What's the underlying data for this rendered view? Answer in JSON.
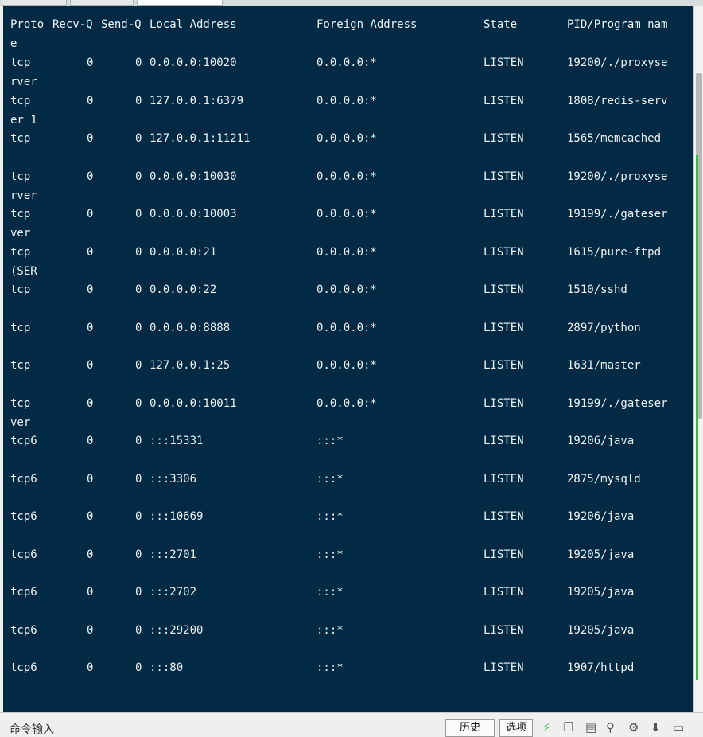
{
  "header": {
    "proto": "Proto",
    "recvq": "Recv-Q",
    "sendq": "Send-Q",
    "local": "Local Address",
    "foreign": "Foreign Address",
    "state": "State",
    "pid": "PID/Program nam",
    "wrap": "e"
  },
  "rows": [
    {
      "proto": "tcp",
      "recvq": "0",
      "sendq": "0",
      "local": "0.0.0.0:10020",
      "foreign": "0.0.0.0:*",
      "state": "LISTEN",
      "pid": "19200/./proxyse",
      "wrap": "rver"
    },
    {
      "proto": "tcp",
      "recvq": "0",
      "sendq": "0",
      "local": "127.0.0.1:6379",
      "foreign": "0.0.0.0:*",
      "state": "LISTEN",
      "pid": "1808/redis-serv",
      "wrap": "er 1"
    },
    {
      "proto": "tcp",
      "recvq": "0",
      "sendq": "0",
      "local": "127.0.0.1:11211",
      "foreign": "0.0.0.0:*",
      "state": "LISTEN",
      "pid": "1565/memcached",
      "wrap": ""
    },
    {
      "proto": "tcp",
      "recvq": "0",
      "sendq": "0",
      "local": "0.0.0.0:10030",
      "foreign": "0.0.0.0:*",
      "state": "LISTEN",
      "pid": "19200/./proxyse",
      "wrap": "rver"
    },
    {
      "proto": "tcp",
      "recvq": "0",
      "sendq": "0",
      "local": "0.0.0.0:10003",
      "foreign": "0.0.0.0:*",
      "state": "LISTEN",
      "pid": "19199/./gateser",
      "wrap": "ver"
    },
    {
      "proto": "tcp",
      "recvq": "0",
      "sendq": "0",
      "local": "0.0.0.0:21",
      "foreign": "0.0.0.0:*",
      "state": "LISTEN",
      "pid": "1615/pure-ftpd",
      "wrap": "(SER"
    },
    {
      "proto": "tcp",
      "recvq": "0",
      "sendq": "0",
      "local": "0.0.0.0:22",
      "foreign": "0.0.0.0:*",
      "state": "LISTEN",
      "pid": "1510/sshd",
      "wrap": ""
    },
    {
      "proto": "tcp",
      "recvq": "0",
      "sendq": "0",
      "local": "0.0.0.0:8888",
      "foreign": "0.0.0.0:*",
      "state": "LISTEN",
      "pid": "2897/python",
      "wrap": ""
    },
    {
      "proto": "tcp",
      "recvq": "0",
      "sendq": "0",
      "local": "127.0.0.1:25",
      "foreign": "0.0.0.0:*",
      "state": "LISTEN",
      "pid": "1631/master",
      "wrap": ""
    },
    {
      "proto": "tcp",
      "recvq": "0",
      "sendq": "0",
      "local": "0.0.0.0:10011",
      "foreign": "0.0.0.0:*",
      "state": "LISTEN",
      "pid": "19199/./gateser",
      "wrap": "ver"
    },
    {
      "proto": "tcp6",
      "recvq": "0",
      "sendq": "0",
      "local": ":::15331",
      "foreign": ":::*",
      "state": "LISTEN",
      "pid": "19206/java",
      "wrap": ""
    },
    {
      "proto": "tcp6",
      "recvq": "0",
      "sendq": "0",
      "local": ":::3306",
      "foreign": ":::*",
      "state": "LISTEN",
      "pid": "2875/mysqld",
      "wrap": ""
    },
    {
      "proto": "tcp6",
      "recvq": "0",
      "sendq": "0",
      "local": ":::10669",
      "foreign": ":::*",
      "state": "LISTEN",
      "pid": "19206/java",
      "wrap": ""
    },
    {
      "proto": "tcp6",
      "recvq": "0",
      "sendq": "0",
      "local": ":::2701",
      "foreign": ":::*",
      "state": "LISTEN",
      "pid": "19205/java",
      "wrap": ""
    },
    {
      "proto": "tcp6",
      "recvq": "0",
      "sendq": "0",
      "local": ":::2702",
      "foreign": ":::*",
      "state": "LISTEN",
      "pid": "19205/java",
      "wrap": ""
    },
    {
      "proto": "tcp6",
      "recvq": "0",
      "sendq": "0",
      "local": ":::29200",
      "foreign": ":::*",
      "state": "LISTEN",
      "pid": "19205/java",
      "wrap": ""
    },
    {
      "proto": "tcp6",
      "recvq": "0",
      "sendq": "0",
      "local": ":::80",
      "foreign": ":::*",
      "state": "LISTEN",
      "pid": "1907/httpd",
      "wrap": ""
    }
  ],
  "bottom": {
    "command_label": "命令输入",
    "history_button": "历史",
    "options_button": "选项"
  },
  "icons": [
    "lightning-icon",
    "copy-icon",
    "paste-icon",
    "search-icon",
    "gear-icon",
    "download-icon",
    "window-icon"
  ],
  "colors": {
    "terminal_bg": "#022a44",
    "terminal_fg": "#eef2f4",
    "accent_green": "#39b54a"
  }
}
